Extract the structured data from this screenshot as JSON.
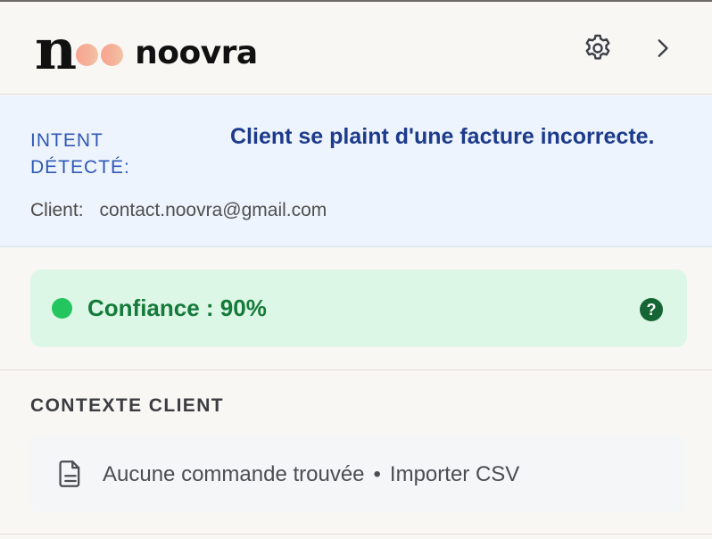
{
  "brand": {
    "n_letter": "n",
    "wordmark": "noovra"
  },
  "header": {
    "settings_icon": "gear-icon",
    "collapse_icon": "chevron-right-icon"
  },
  "intent": {
    "label": "INTENT DÉTECTÉ:",
    "text": "Client se plaint d'une facture incorrecte.",
    "client_label": "Client:",
    "client_email": "contact.noovra@gmail.com"
  },
  "confidence": {
    "text": "Confiance : 90%",
    "value_percent": 90,
    "help_glyph": "?",
    "status_color": "#22c55e"
  },
  "context": {
    "title": "CONTEXTE CLIENT",
    "icon": "document-icon",
    "no_orders": "Aucune commande trouvée",
    "separator": "•",
    "import_label": "Importer CSV"
  },
  "colors": {
    "accent_blue": "#1d3b8c",
    "success_green": "#157a3a",
    "logo_gradient_start": "#f9a38f",
    "logo_gradient_end": "#f2c5a6"
  }
}
